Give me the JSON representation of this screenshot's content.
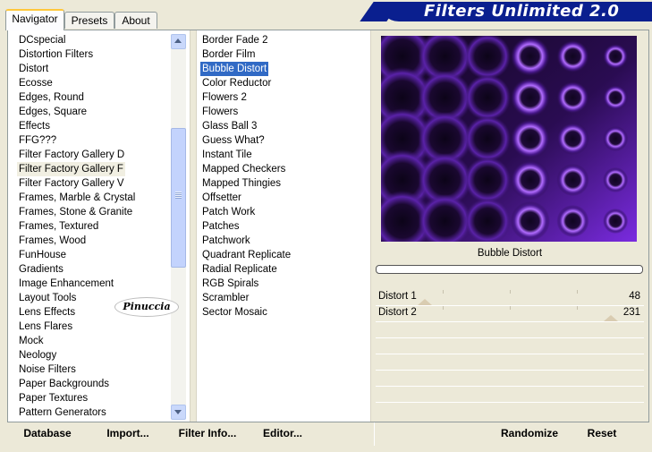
{
  "header": {
    "title": "Filters Unlimited 2.0"
  },
  "tabs": [
    {
      "label": "Navigator",
      "active": true
    },
    {
      "label": "Presets",
      "active": false
    },
    {
      "label": "About",
      "active": false
    }
  ],
  "categories": {
    "items": [
      "DCspecial",
      "Distortion Filters",
      "Distort",
      "Ecosse",
      "Edges, Round",
      "Edges, Square",
      "Effects",
      "FFG???",
      "Filter Factory Gallery D",
      "Filter Factory Gallery F",
      "Filter Factory Gallery V",
      "Frames, Marble & Crystal",
      "Frames, Stone & Granite",
      "Frames, Textured",
      "Frames, Wood",
      "FunHouse",
      "Gradients",
      "Image Enhancement",
      "Layout Tools",
      "Lens Effects",
      "Lens Flares",
      "Mock",
      "Neology",
      "Noise Filters",
      "Paper Backgrounds",
      "Paper Textures",
      "Pattern Generators"
    ],
    "selected_index": 9
  },
  "filters": {
    "items": [
      "Border Fade 2",
      "Border Film",
      "Bubble Distort",
      "Color Reductor",
      "Flowers 2",
      "Flowers",
      "Glass Ball 3",
      "Guess What?",
      "Instant Tile",
      "Mapped Checkers",
      "Mapped Thingies",
      "Offsetter",
      "Patch Work",
      "Patches",
      "Patchwork",
      "Quadrant Replicate",
      "Radial Replicate",
      "RGB Spirals",
      "Scrambler",
      "Sector Mosaic"
    ],
    "selected_index": 2
  },
  "preview": {
    "filter_name": "Bubble Distort"
  },
  "sliders": [
    {
      "label": "Distort 1",
      "value": "48",
      "level": 0.188
    },
    {
      "label": "Distort 2",
      "value": "231",
      "level": 0.906
    }
  ],
  "watermark": {
    "text": "Pinuccia"
  },
  "buttons": {
    "database": "Database",
    "import": "Import...",
    "filter_info": "Filter Info...",
    "editor": "Editor...",
    "randomize": "Randomize",
    "reset": "Reset"
  },
  "colors": {
    "banner": "#0a1f8f",
    "selection": "#316ac5",
    "preview_accent": "#8a2be2"
  }
}
